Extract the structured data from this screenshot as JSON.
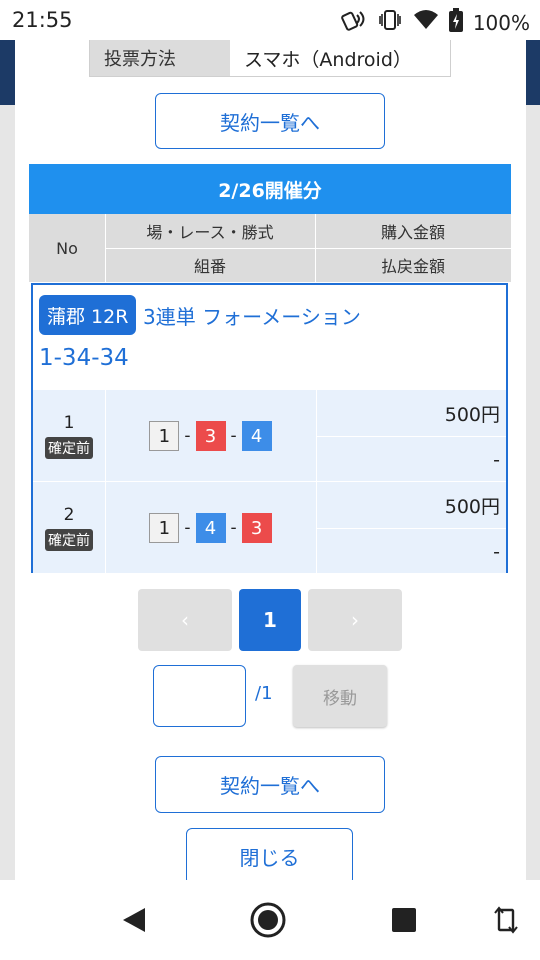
{
  "status_bar": {
    "time": "21:55",
    "battery": "100%",
    "icons": [
      "nfc-icon",
      "vibrate-icon",
      "wifi-icon",
      "battery-charging-icon"
    ]
  },
  "vote_method": {
    "label": "投票方法",
    "value": "スマホ（Android）"
  },
  "contract_list_button": "契約一覧へ",
  "date_header": "2/26開催分",
  "table_header": {
    "no": "No",
    "venue_race_type": "場・レース・勝式",
    "purchase_amount": "購入金額",
    "combination": "組番",
    "payout_amount": "払戻金額"
  },
  "bet": {
    "venue_race": "蒲郡 12R",
    "bet_type": "3連単 フォーメーション",
    "combination_title": "1-34-34",
    "rows": [
      {
        "no": "1",
        "status": "確定前",
        "boats": [
          "1",
          "3",
          "4"
        ],
        "purchase": "500円",
        "payout": "-"
      },
      {
        "no": "2",
        "status": "確定前",
        "boats": [
          "1",
          "4",
          "3"
        ],
        "purchase": "500円",
        "payout": "-"
      }
    ]
  },
  "pagination": {
    "prev": "‹",
    "current": "1",
    "next": "›",
    "input_value": "",
    "total": "/1",
    "move_button": "移動"
  },
  "contract_list_button_bottom": "契約一覧へ",
  "close_button": "閉じる",
  "colors": {
    "accent_blue": "#1f6fd6",
    "header_blue": "#1f90ee",
    "boat_red": "#ec4b4b",
    "boat_blue": "#3d8de8",
    "row_bg": "#e8f1fc"
  }
}
